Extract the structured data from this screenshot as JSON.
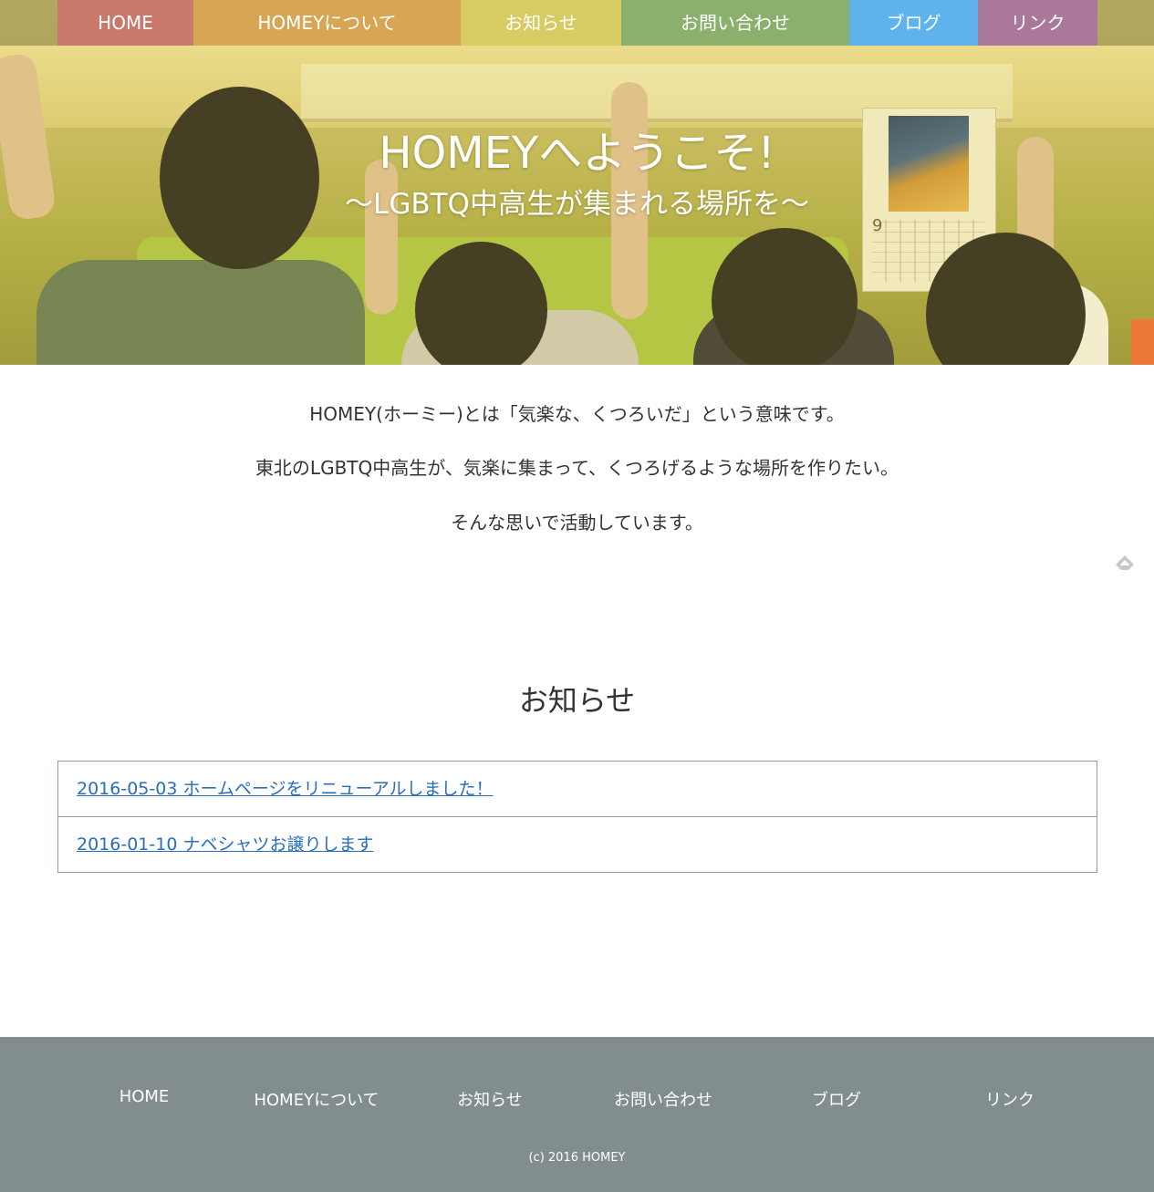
{
  "nav": {
    "items": [
      {
        "label": "HOME",
        "color": "#c9786c"
      },
      {
        "label": "HOMEYについて",
        "color": "#d6a655"
      },
      {
        "label": "お知らせ",
        "color": "#d7cb64"
      },
      {
        "label": "お問い合わせ",
        "color": "#8bb06e"
      },
      {
        "label": "ブログ",
        "color": "#5fb3ec"
      },
      {
        "label": "リンク",
        "color": "#a9789a"
      }
    ]
  },
  "hero": {
    "title": "HOMEYへようこそ!",
    "subtitle": "〜LGBTQ中高生が集まれる場所を〜",
    "calendar_month": "9"
  },
  "intro": {
    "line1": "HOMEY(ホーミー)とは「気楽な、くつろいだ」という意味です。",
    "line2": "東北のLGBTQ中高生が、気楽に集まって、くつろげるような場所を作りたい。",
    "line3": "そんな思いで活動しています。"
  },
  "news": {
    "title": "お知らせ",
    "items": [
      {
        "text": "2016-05-03 ホームページをリニューアルしました！"
      },
      {
        "text": "2016-01-10 ナベシャツお譲りします"
      }
    ]
  },
  "footer": {
    "links": [
      "HOME",
      "HOMEYについて",
      "お知らせ",
      "お問い合わせ",
      "ブログ",
      "リンク"
    ],
    "copyright": "(c) 2016 HOMEY",
    "background": "#828e8e"
  },
  "icons": {
    "feedly": "feedly-icon"
  }
}
